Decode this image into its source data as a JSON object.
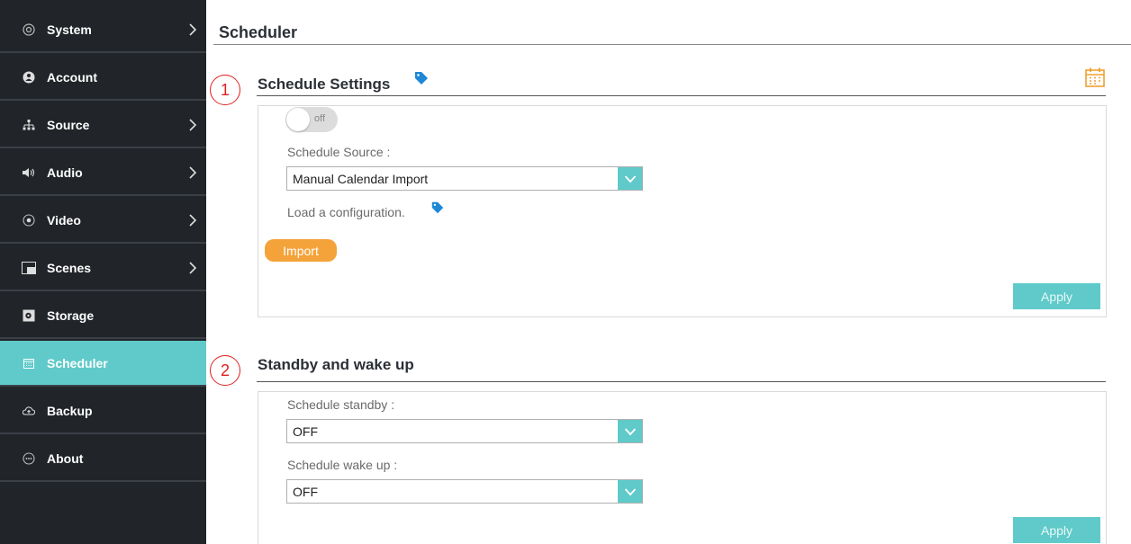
{
  "sidebar": {
    "items": [
      {
        "label": "System",
        "icon": "settings-icon",
        "has_submenu": true
      },
      {
        "label": "Account",
        "icon": "account-icon",
        "has_submenu": false
      },
      {
        "label": "Source",
        "icon": "source-tree-icon",
        "has_submenu": true
      },
      {
        "label": "Audio",
        "icon": "speaker-icon",
        "has_submenu": true
      },
      {
        "label": "Video",
        "icon": "video-icon",
        "has_submenu": true
      },
      {
        "label": "Scenes",
        "icon": "scenes-icon",
        "has_submenu": true
      },
      {
        "label": "Storage",
        "icon": "storage-icon",
        "has_submenu": false
      },
      {
        "label": "Scheduler",
        "icon": "calendar-icon",
        "has_submenu": false,
        "active": true
      },
      {
        "label": "Backup",
        "icon": "backup-icon",
        "has_submenu": false
      },
      {
        "label": "About",
        "icon": "about-icon",
        "has_submenu": false
      }
    ]
  },
  "main": {
    "title": "Scheduler",
    "markers": [
      "1",
      "2"
    ],
    "schedule_settings": {
      "title": "Schedule Settings",
      "toggle_state": "off",
      "source_label": "Schedule Source :",
      "source_value": "Manual Calendar Import",
      "load_text": "Load a configuration.",
      "import_label": "Import",
      "apply_label": "Apply"
    },
    "standby": {
      "title": "Standby and wake up",
      "standby_label": "Schedule standby :",
      "standby_value": "OFF",
      "wake_label": "Schedule wake up :",
      "wake_value": "OFF",
      "apply_label": "Apply"
    }
  },
  "colors": {
    "sidebar_bg": "#212529",
    "active": "#5fcac9",
    "import": "#f4a33a",
    "tag_icon": "#1e88d6",
    "marker": "#e02020"
  }
}
